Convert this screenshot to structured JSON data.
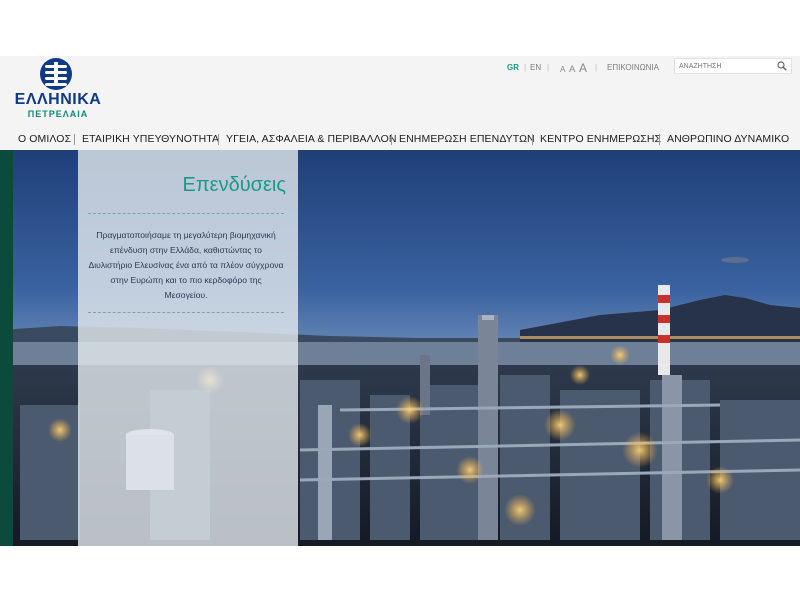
{
  "brand": {
    "name_line1": "ΕΛΛΗΝΙΚΑ",
    "name_line2": "ΠΕΤΡΕΛΑΙΑ",
    "logo_icon": "globe-cross-icon",
    "colors": {
      "blue": "#0f3a86",
      "teal": "#1a9a86",
      "dark_green": "#0c4a3c"
    }
  },
  "utility": {
    "lang_gr": "GR",
    "lang_en": "EN",
    "font_small": "A",
    "font_medium": "A",
    "font_large": "A",
    "contact": "ΕΠΙΚΟΙΝΩΝΙΑ",
    "search_placeholder": "ΑΝΑΖΗΤΗΣΗ",
    "search_icon": "search-icon"
  },
  "nav": {
    "items": [
      "Ο ΟΜΙΛΟΣ",
      "ΕΤΑΙΡΙΚΗ ΥΠΕΥΘΥΝΟΤΗΤΑ",
      "ΥΓΕΙΑ, ΑΣΦΑΛΕΙΑ & ΠΕΡΙΒΑΛΛΟΝ",
      "ΕΝΗΜΕΡΩΣΗ ΕΠΕΝΔΥΤΩΝ",
      "ΚΕΝΤΡΟ ΕΝΗΜΕΡΩΣΗΣ",
      "ΑΝΘΡΩΠΙΝΟ ΔΥΝΑΜΙΚΟ"
    ]
  },
  "hero": {
    "title": "Επενδύσεις",
    "body": "Πραγματοποιήσαμε τη μεγαλύτερη βιομηχανική επένδυση στην Ελλάδα, καθιστώντας το Διυλιστήριο Ελευσίνας ένα από τα πλέον σύγχρονα στην Ευρώπη και το πιο κερδοφόρο της Μεσογείου."
  }
}
